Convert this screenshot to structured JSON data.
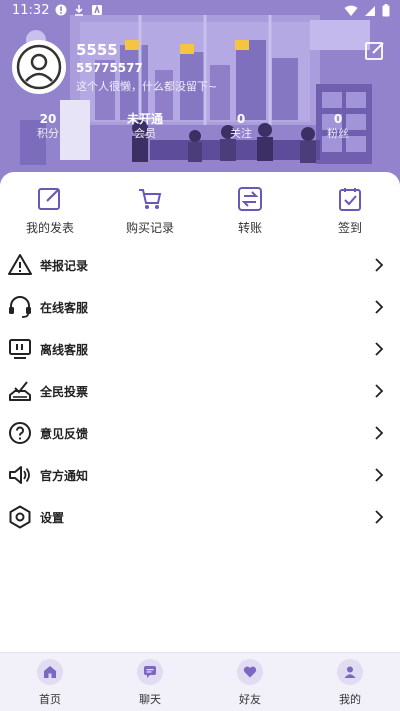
{
  "status_bar": {
    "time": "11:32"
  },
  "profile": {
    "username": "5555",
    "user_id": "55775577",
    "signature": "这个人很懒，什么都没留下~"
  },
  "stats": [
    {
      "value": "20",
      "label": "积分"
    },
    {
      "value": "未开通",
      "label": "会员"
    },
    {
      "value": "0",
      "label": "关注"
    },
    {
      "value": "0",
      "label": "粉丝"
    }
  ],
  "quick_actions": [
    {
      "label": "我的发表",
      "icon": "edit-icon"
    },
    {
      "label": "购买记录",
      "icon": "cart-icon"
    },
    {
      "label": "转账",
      "icon": "transfer-icon"
    },
    {
      "label": "签到",
      "icon": "checkin-icon"
    }
  ],
  "menu": [
    {
      "label": "举报记录",
      "icon": "warning-icon"
    },
    {
      "label": "在线客服",
      "icon": "headset-icon"
    },
    {
      "label": "离线客服",
      "icon": "monitor-icon"
    },
    {
      "label": "全民投票",
      "icon": "vote-icon"
    },
    {
      "label": "意见反馈",
      "icon": "question-icon"
    },
    {
      "label": "官方通知",
      "icon": "speaker-icon"
    },
    {
      "label": "设置",
      "icon": "settings-icon"
    }
  ],
  "bottom_nav": [
    {
      "label": "首页",
      "icon": "home-icon"
    },
    {
      "label": "聊天",
      "icon": "chat-icon"
    },
    {
      "label": "好友",
      "icon": "heart-icon"
    },
    {
      "label": "我的",
      "icon": "user-icon"
    }
  ],
  "colors": {
    "accent": "#7a68c2",
    "header_bg": "#8f7fc9",
    "nav_bg": "#f2f0f8"
  }
}
